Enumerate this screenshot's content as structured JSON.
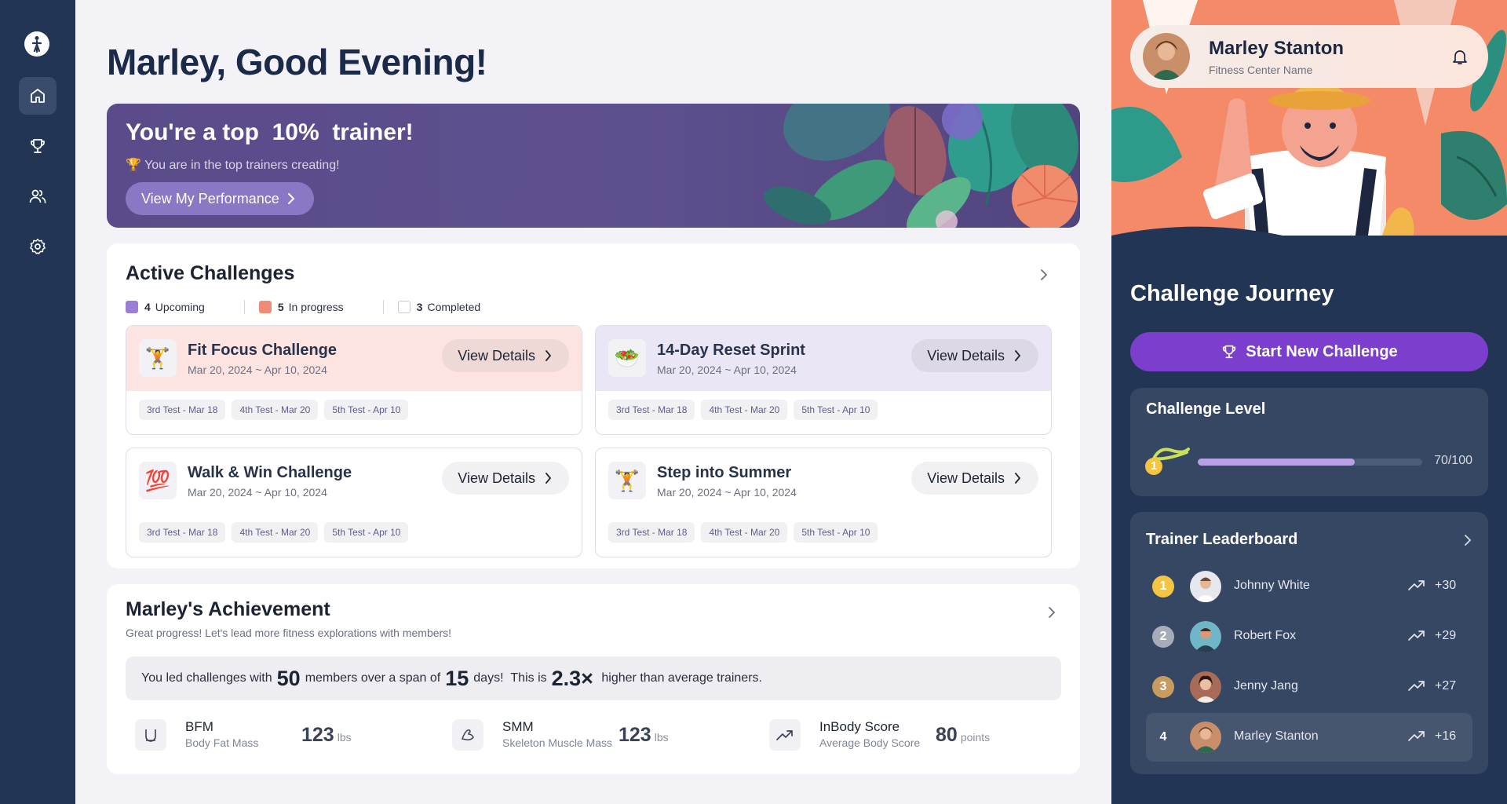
{
  "app": {
    "accent": "#7c3fcd",
    "sidebar_bg": "#233554"
  },
  "nav": [
    {
      "name": "home-icon",
      "active": true
    },
    {
      "name": "trophy-icon",
      "active": false
    },
    {
      "name": "users-icon",
      "active": false
    },
    {
      "name": "settings-icon",
      "active": false
    }
  ],
  "greeting": "Marley, Good Evening!",
  "banner": {
    "title_pre": "You're a top",
    "title_pct": "10%",
    "title_post": "trainer!",
    "subtitle": "🏆 You are in the top trainers creating!",
    "button": "View My Performance"
  },
  "active_challenges": {
    "title": "Active Challenges",
    "legend": [
      {
        "count": "4",
        "label": "Upcoming",
        "color": "#9b7fd6"
      },
      {
        "count": "5",
        "label": "In progress",
        "color": "#f08b78"
      },
      {
        "count": "3",
        "label": "Completed",
        "color": "#ffffff"
      }
    ],
    "items": [
      {
        "icon": "🏋️",
        "name": "Fit Focus Challenge",
        "dates": "Mar 20, 2024 ~ Apr 10, 2024",
        "button": "View Details",
        "header_bg": "#fde4e1",
        "tags": [
          "3rd Test - Mar 18",
          "4th Test - Mar 20",
          "5th Test - Apr 10"
        ]
      },
      {
        "icon": "🥗",
        "name": "14-Day Reset Sprint",
        "dates": "Mar 20, 2024 ~ Apr 10, 2024",
        "button": "View Details",
        "header_bg": "#ebe6f5",
        "tags": [
          "3rd Test - Mar 18",
          "4th Test - Mar 20",
          "5th Test - Apr 10"
        ]
      },
      {
        "icon": "💯",
        "name": "Walk & Win Challenge",
        "dates": "Mar 20, 2024 ~ Apr 10, 2024",
        "button": "View Details",
        "header_bg": "#ffffff",
        "tags": [
          "3rd Test - Mar 18",
          "4th Test - Mar 20",
          "5th Test - Apr 10"
        ]
      },
      {
        "icon": "🏋️",
        "name": "Step into Summer",
        "dates": "Mar 20, 2024 ~ Apr 10, 2024",
        "button": "View Details",
        "header_bg": "#ffffff",
        "tags": [
          "3rd Test - Mar 18",
          "4th Test - Mar 20",
          "5th Test - Apr 10"
        ]
      }
    ]
  },
  "achievement": {
    "title": "Marley's Achievement",
    "subtitle": "Great progress! Let's lead more fitness explorations with members!",
    "summary": {
      "t1": "You led challenges with",
      "members": "50",
      "t2": "members over a span of",
      "days": "15",
      "t3": "days!",
      "t4": "This is",
      "factor": "2.3×",
      "t5": "higher than average trainers."
    },
    "metrics": [
      {
        "icon": "bfm-icon",
        "label": "BFM",
        "sub": "Body Fat Mass",
        "value": "123",
        "unit": "lbs"
      },
      {
        "icon": "muscle-icon",
        "label": "SMM",
        "sub": "Skeleton Muscle Mass",
        "value": "123",
        "unit": "lbs"
      },
      {
        "icon": "trend-up-icon",
        "label": "InBody Score",
        "sub": "Average Body Score",
        "value": "80",
        "unit": "points"
      }
    ]
  },
  "profile": {
    "name": "Marley Stanton",
    "center": "Fitness Center Name"
  },
  "journey": {
    "title": "Challenge Journey",
    "start_button": "Start New Challenge",
    "level": {
      "title": "Challenge Level",
      "badge": "1",
      "value_text": "70/100",
      "progress": 0.7
    }
  },
  "leaderboard": {
    "title": "Trainer Leaderboard",
    "rows": [
      {
        "rank": "1",
        "name": "Johnny White",
        "score": "+30",
        "rank_color": "#f4c542"
      },
      {
        "rank": "2",
        "name": "Robert Fox",
        "score": "+29",
        "rank_color": "#a7adb8"
      },
      {
        "rank": "3",
        "name": "Jenny Jang",
        "score": "+27",
        "rank_color": "#c99b5e"
      },
      {
        "rank": "4",
        "name": "Marley Stanton",
        "score": "+16",
        "rank_color": "transparent"
      }
    ]
  }
}
